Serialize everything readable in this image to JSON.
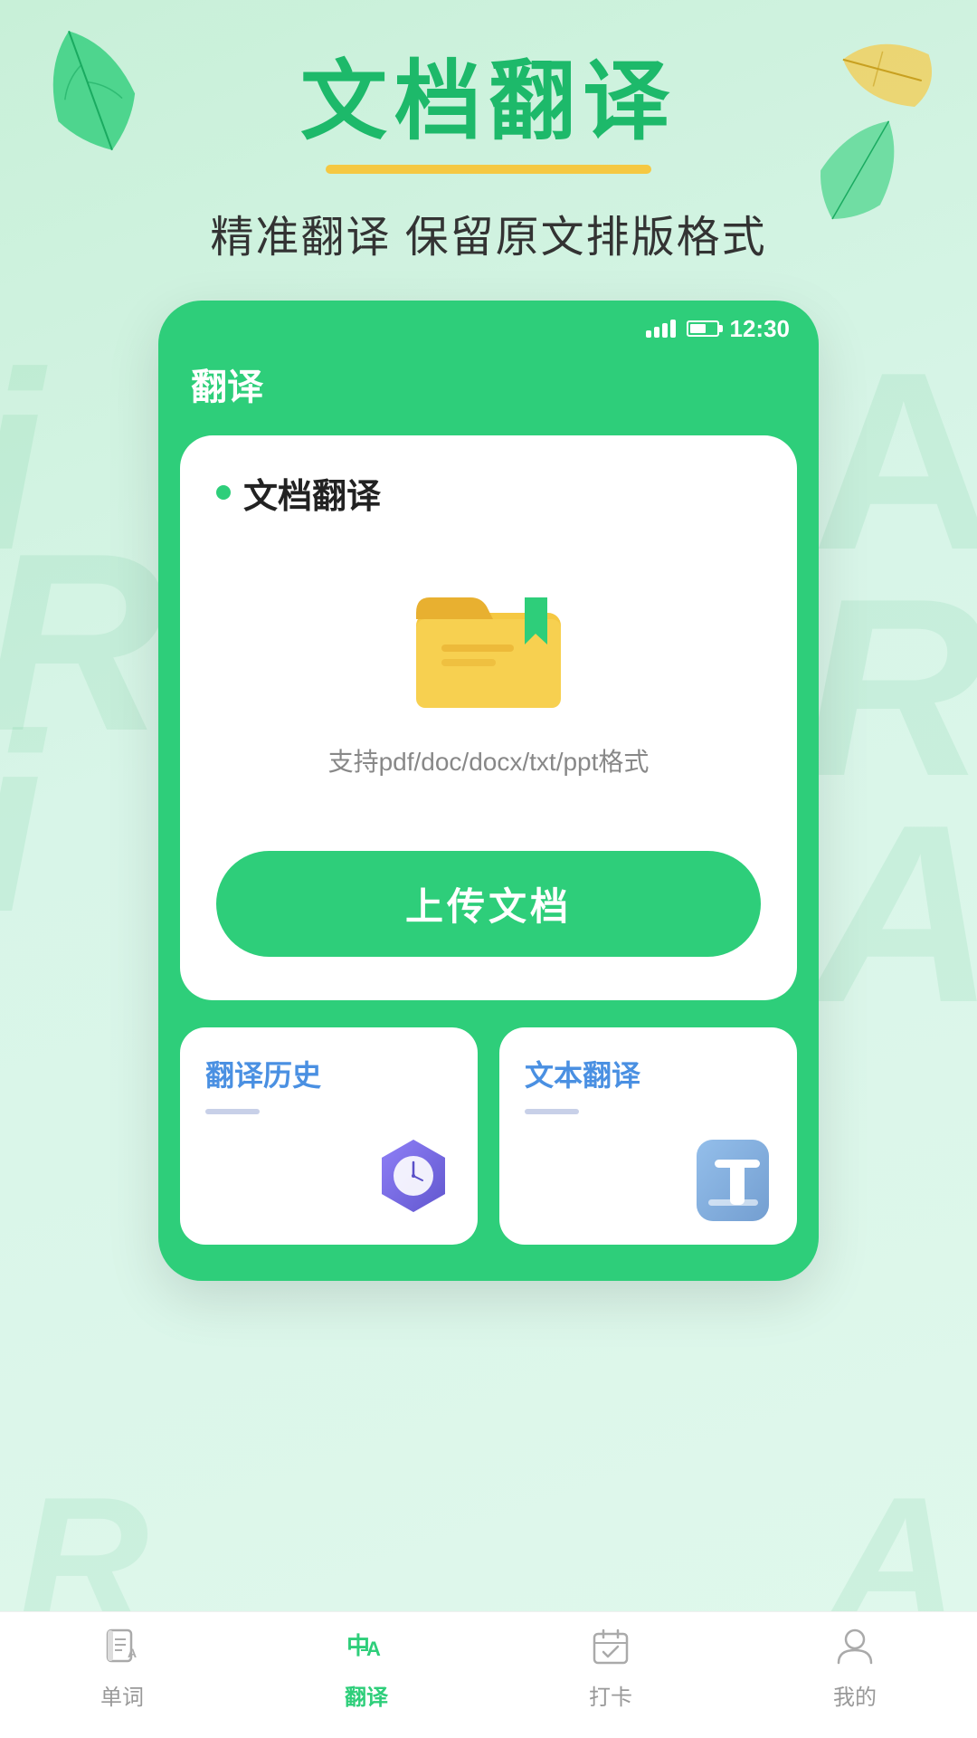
{
  "hero": {
    "title": "文档翻译",
    "subtitle": "精准翻译 保留原文排版格式"
  },
  "phone": {
    "status_bar": {
      "time": "12:30"
    },
    "app_title": "翻译",
    "doc_section": {
      "label": "文档翻译",
      "supported_formats": "支持pdf/doc/docx/txt/ppt格式",
      "upload_button": "上传文档"
    },
    "history_card": {
      "title": "翻译历史"
    },
    "text_card": {
      "title": "文本翻译"
    }
  },
  "nav": {
    "items": [
      {
        "label": "单词",
        "active": false
      },
      {
        "label": "翻译",
        "active": true
      },
      {
        "label": "打卡",
        "active": false
      },
      {
        "label": "我的",
        "active": false
      }
    ]
  },
  "bg_letters": [
    "i",
    "R",
    "i",
    "A",
    "R",
    "A",
    "R",
    "A"
  ]
}
